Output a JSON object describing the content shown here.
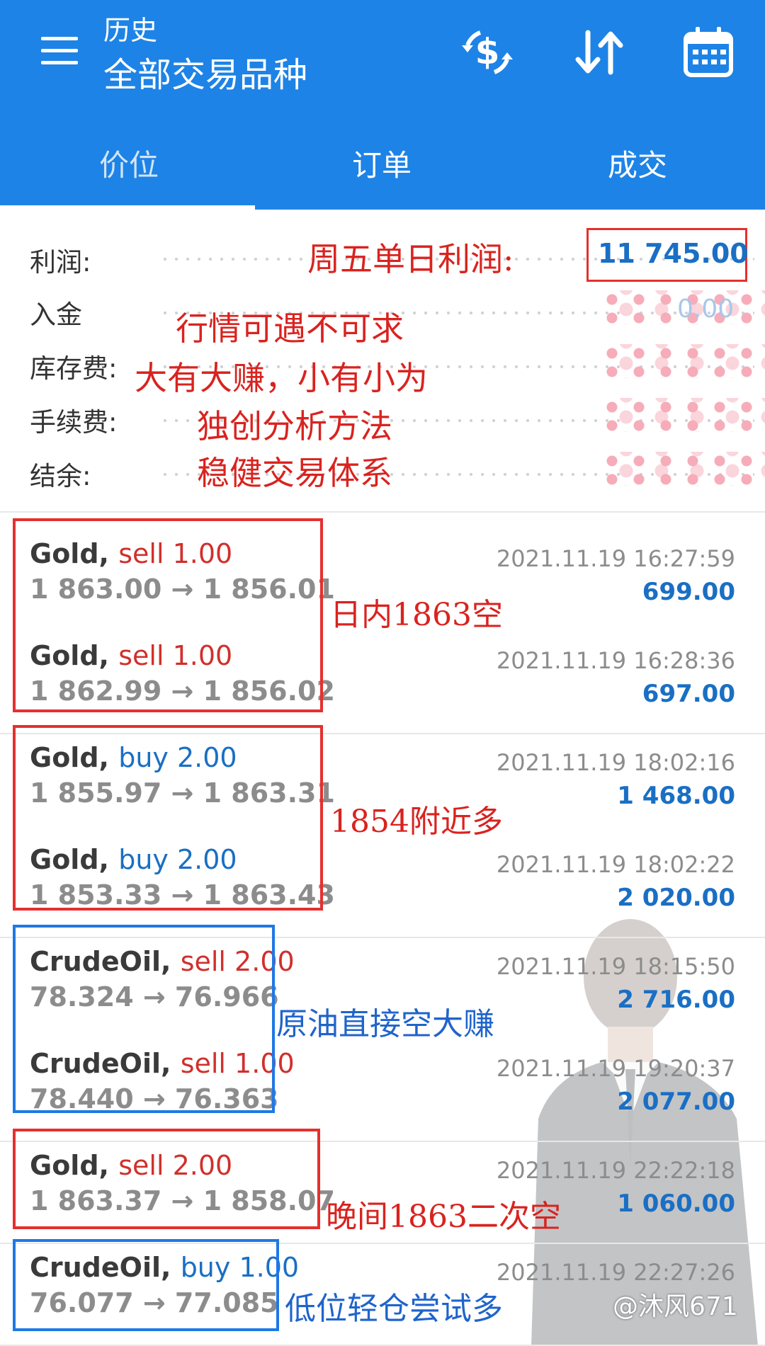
{
  "header": {
    "title_small": "历史",
    "title_big": "全部交易品种",
    "icons": [
      "menu-icon",
      "dollar-sync-icon",
      "sort-icon",
      "calendar-icon"
    ]
  },
  "tabs": [
    "价位",
    "订单",
    "成交"
  ],
  "summary": {
    "labels": [
      "利润:",
      "入金",
      "库存费:",
      "手续费:",
      "结余:"
    ],
    "profit_value": "11 745.00",
    "deposit_value": "0.00"
  },
  "annotations": {
    "profit_note": "周五单日利润:",
    "lines": [
      "行情可遇不可求",
      "大有大赚，小有小为",
      "独创分析方法",
      "稳健交易体系"
    ],
    "group1": "日内1863空",
    "group2": "1854附近多",
    "group3": "原油直接空大赚",
    "group4": "晚间1863二次空",
    "group5": "低位轻仓尝试多"
  },
  "trades": [
    {
      "symbol": "Gold,",
      "side": "sell 1.00",
      "dir": "sell",
      "prices": "1 863.00 → 1 856.01",
      "time": "2021.11.19 16:27:59",
      "profit": "699.00"
    },
    {
      "symbol": "Gold,",
      "side": "sell 1.00",
      "dir": "sell",
      "prices": "1 862.99 → 1 856.02",
      "time": "2021.11.19 16:28:36",
      "profit": "697.00"
    },
    {
      "symbol": "Gold,",
      "side": "buy 2.00",
      "dir": "buy",
      "prices": "1 855.97 → 1 863.31",
      "time": "2021.11.19 18:02:16",
      "profit": "1 468.00"
    },
    {
      "symbol": "Gold,",
      "side": "buy 2.00",
      "dir": "buy",
      "prices": "1 853.33 → 1 863.43",
      "time": "2021.11.19 18:02:22",
      "profit": "2 020.00"
    },
    {
      "symbol": "CrudeOil,",
      "side": "sell 2.00",
      "dir": "sell",
      "prices": "78.324 → 76.966",
      "time": "2021.11.19 18:15:50",
      "profit": "2 716.00"
    },
    {
      "symbol": "CrudeOil,",
      "side": "sell 1.00",
      "dir": "sell",
      "prices": "78.440 → 76.363",
      "time": "2021.11.19 19:20:37",
      "profit": "2 077.00"
    },
    {
      "symbol": "Gold,",
      "side": "sell 2.00",
      "dir": "sell",
      "prices": "1 863.37 → 1 858.07",
      "time": "2021.11.19 22:22:18",
      "profit": "1 060.00"
    },
    {
      "symbol": "CrudeOil,",
      "side": "buy 1.00",
      "dir": "buy",
      "prices": "76.077 → 77.085",
      "time": "2021.11.19 22:27:26",
      "profit": ""
    }
  ],
  "watermark": "@沐风671",
  "colors": {
    "appbar": "#1e83e6",
    "annotation_red": "#d9231f",
    "annotation_blue": "#1f64cc",
    "sell": "#d0302c",
    "buy": "#1a6fc4"
  }
}
